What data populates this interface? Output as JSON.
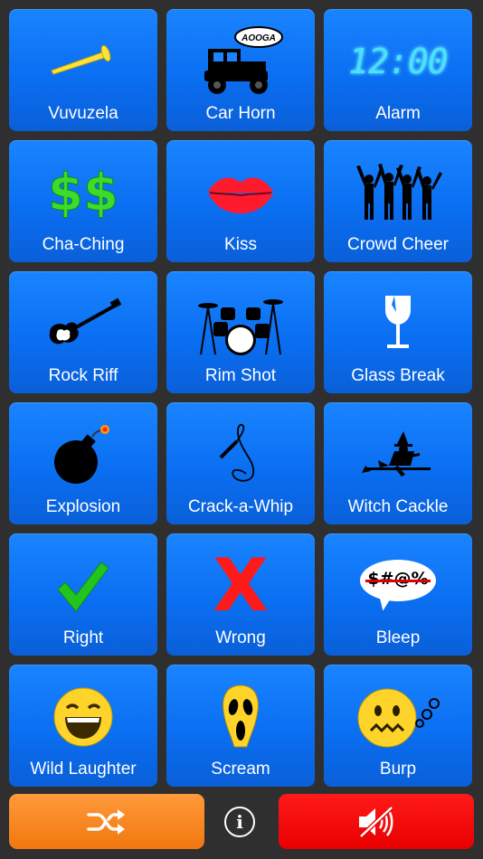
{
  "colors": {
    "tile_blue": "#0a6ff2",
    "background": "#2f2f2f",
    "shuffle_orange": "#f2770f",
    "mute_red": "#e80000"
  },
  "tiles": [
    {
      "label": "Vuvuzela",
      "icon": "vuvuzela-icon"
    },
    {
      "label": "Car Horn",
      "icon": "car-horn-icon",
      "badge": "AOOGA"
    },
    {
      "label": "Alarm",
      "icon": "alarm-clock-icon",
      "display": "12:00"
    },
    {
      "label": "Cha-Ching",
      "icon": "dollar-signs-icon",
      "symbol": "$$"
    },
    {
      "label": "Kiss",
      "icon": "lips-icon"
    },
    {
      "label": "Crowd Cheer",
      "icon": "crowd-icon"
    },
    {
      "label": "Rock Riff",
      "icon": "guitar-icon"
    },
    {
      "label": "Rim Shot",
      "icon": "drum-kit-icon"
    },
    {
      "label": "Glass Break",
      "icon": "broken-glass-icon"
    },
    {
      "label": "Explosion",
      "icon": "bomb-icon"
    },
    {
      "label": "Crack-a-Whip",
      "icon": "whip-icon"
    },
    {
      "label": "Witch Cackle",
      "icon": "witch-icon"
    },
    {
      "label": "Right",
      "icon": "checkmark-icon"
    },
    {
      "label": "Wrong",
      "icon": "x-mark-icon",
      "symbol": "X"
    },
    {
      "label": "Bleep",
      "icon": "censored-speech-icon",
      "symbol": "$#@%"
    },
    {
      "label": "Wild Laughter",
      "icon": "laughing-face-icon"
    },
    {
      "label": "Scream",
      "icon": "scream-mask-icon"
    },
    {
      "label": "Burp",
      "icon": "burp-face-icon"
    }
  ],
  "bottom": {
    "shuffle_icon": "shuffle-icon",
    "info_symbol": "i",
    "mute_icon": "speaker-muted-icon"
  }
}
